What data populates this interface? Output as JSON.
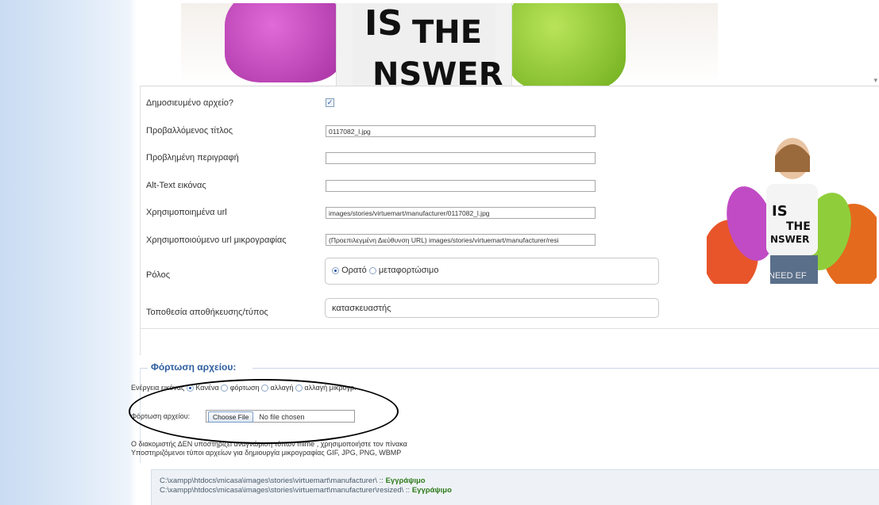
{
  "form": {
    "published_label": "Δημοσιευμένο αρχείο?",
    "published_check": "✓",
    "title_label": "Προβαλλόμενος τίτλος",
    "title_value": "0117082_l.jpg",
    "desc_label": "Προβλημένη περιγραφή",
    "desc_value": "",
    "alt_label": "Alt-Text εικόνας",
    "alt_value": "",
    "url_label": "Χρησιμοποιημένα url",
    "url_value": "images/stories/virtuemart/manufacturer/0117082_l.jpg",
    "thumb_label": "Χρησιμοποιούμενο url μικρογραφίας",
    "thumb_value": "(Προεπιλεγμένη Διεύθυνση URL) images/stories/virtuemart/manufacturer/resi",
    "role_label": "Ρόλος",
    "role_options": [
      "Ορατό",
      "μεταφορτώσιμο"
    ],
    "storage_label": "Τοποθεσία αποθήκευσης/τύπος",
    "storage_value": "κατασκευαστής"
  },
  "preview": {
    "watermark": "NEED EF"
  },
  "upload": {
    "legend": "Φόρτωση αρχείου:",
    "action_label": "Ενέργεια εικόνας",
    "actions": [
      "Κανένα",
      "φόρτωση",
      "αλλαγή",
      "αλλαγή μικρογρ."
    ],
    "file_label": "Φόρτωση αρχείου:",
    "choose_button": "Choose File",
    "no_file": "No file chosen",
    "note1": "Ο διακομιστής ΔΕΝ υποστηρίζει αναγνώριση τύπων mime , χρησιμοποιήστε τον πίνακα",
    "note2": "Υποστηριζόμενοι τύποι αρχείων για δημιουργία μικρογραφίας GIF, JPG, PNG, WBMP"
  },
  "status": {
    "path1": "C:\\xampp\\htdocs\\micasa\\images\\stories\\virtuemart\\manufacturer\\ ::",
    "path2": "C:\\xampp\\htdocs\\micasa\\images\\stories\\virtuemart\\manufacturer\\resized\\ ::",
    "writable": "Εγγράψιμο"
  },
  "colors": {
    "accent": "#2d5ea0",
    "writable": "#2f7a1a"
  }
}
